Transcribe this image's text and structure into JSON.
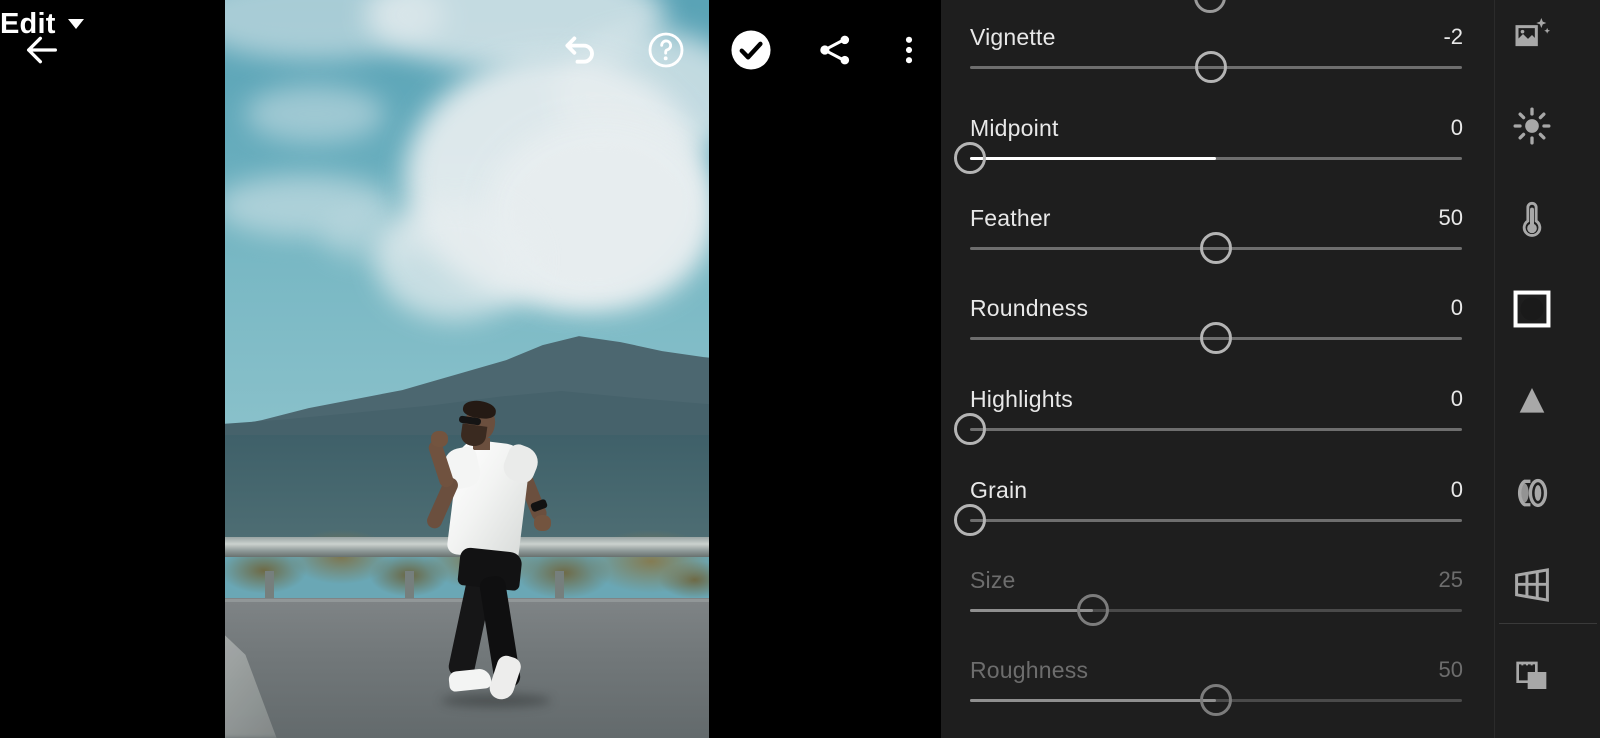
{
  "app": {
    "title": "Photo Editor",
    "mode": "Edit"
  },
  "toolbar": {
    "back": {
      "name": "Back",
      "icon": "arrow-left-icon"
    },
    "edit_menu": {
      "label": "Edit",
      "caret": "chevron-down-icon"
    },
    "undo": {
      "name": "Undo",
      "icon": "undo-icon"
    },
    "help": {
      "name": "Help",
      "icon": "help-circle-icon"
    },
    "confirm": {
      "name": "Done",
      "icon": "check-circle-icon"
    },
    "share": {
      "name": "Share",
      "icon": "share-icon"
    },
    "more": {
      "name": "More options",
      "icon": "more-vertical-icon"
    }
  },
  "panel": {
    "group": "Effects",
    "sliders": [
      {
        "label": "Vignette",
        "value": "-2",
        "pos": 48.9,
        "fill_from": 48.9,
        "fill_to": 48.9,
        "disabled": false
      },
      {
        "label": "Midpoint",
        "value": "0",
        "pos": 0.0,
        "fill_from": 0.0,
        "fill_to": 50.0,
        "disabled": false
      },
      {
        "label": "Feather",
        "value": "50",
        "pos": 50.0,
        "fill_from": 50.0,
        "fill_to": 50.0,
        "disabled": false
      },
      {
        "label": "Roundness",
        "value": "0",
        "pos": 50.0,
        "fill_from": 50.0,
        "fill_to": 50.0,
        "disabled": false
      },
      {
        "label": "Highlights",
        "value": "0",
        "pos": 0.0,
        "fill_from": 0.0,
        "fill_to": 0.0,
        "disabled": false
      },
      {
        "label": "Grain",
        "value": "0",
        "pos": 0.0,
        "fill_from": 0.0,
        "fill_to": 0.0,
        "disabled": false
      },
      {
        "label": "Size",
        "value": "25",
        "pos": 25.0,
        "fill_from": 0.0,
        "fill_to": 25.0,
        "disabled": true
      },
      {
        "label": "Roughness",
        "value": "50",
        "pos": 50.0,
        "fill_from": 0.0,
        "fill_to": 50.0,
        "disabled": true
      }
    ]
  },
  "rail": {
    "items": [
      {
        "name": "auto-enhance-icon",
        "label": "Auto",
        "active": false
      },
      {
        "name": "light-icon",
        "label": "Light",
        "active": false
      },
      {
        "name": "color-icon",
        "label": "Color",
        "active": false
      },
      {
        "name": "effects-icon",
        "label": "Effects",
        "active": true
      },
      {
        "name": "detail-icon",
        "label": "Detail",
        "active": false
      },
      {
        "name": "optics-icon",
        "label": "Optics",
        "active": false
      },
      {
        "name": "geometry-icon",
        "label": "Geometry",
        "active": false
      },
      {
        "name": "presets-icon",
        "label": "Presets",
        "active": false
      }
    ]
  },
  "photo": {
    "alt": "Man running on a road beside a guardrail with mountains and clouds",
    "colors": {
      "sky": "#63aabb",
      "mountain": "#4c6770",
      "road": "#72787a",
      "shirt": "#ffffff",
      "pants": "#121213"
    }
  },
  "colors": {
    "panel_bg": "#1e1e1e",
    "canvas_bg": "#000000",
    "text": "#e8e8e8",
    "text_dim": "#6d6d6d",
    "track": "#6e6e6e",
    "fill": "#ffffff",
    "knob": "#b4b4b4"
  }
}
